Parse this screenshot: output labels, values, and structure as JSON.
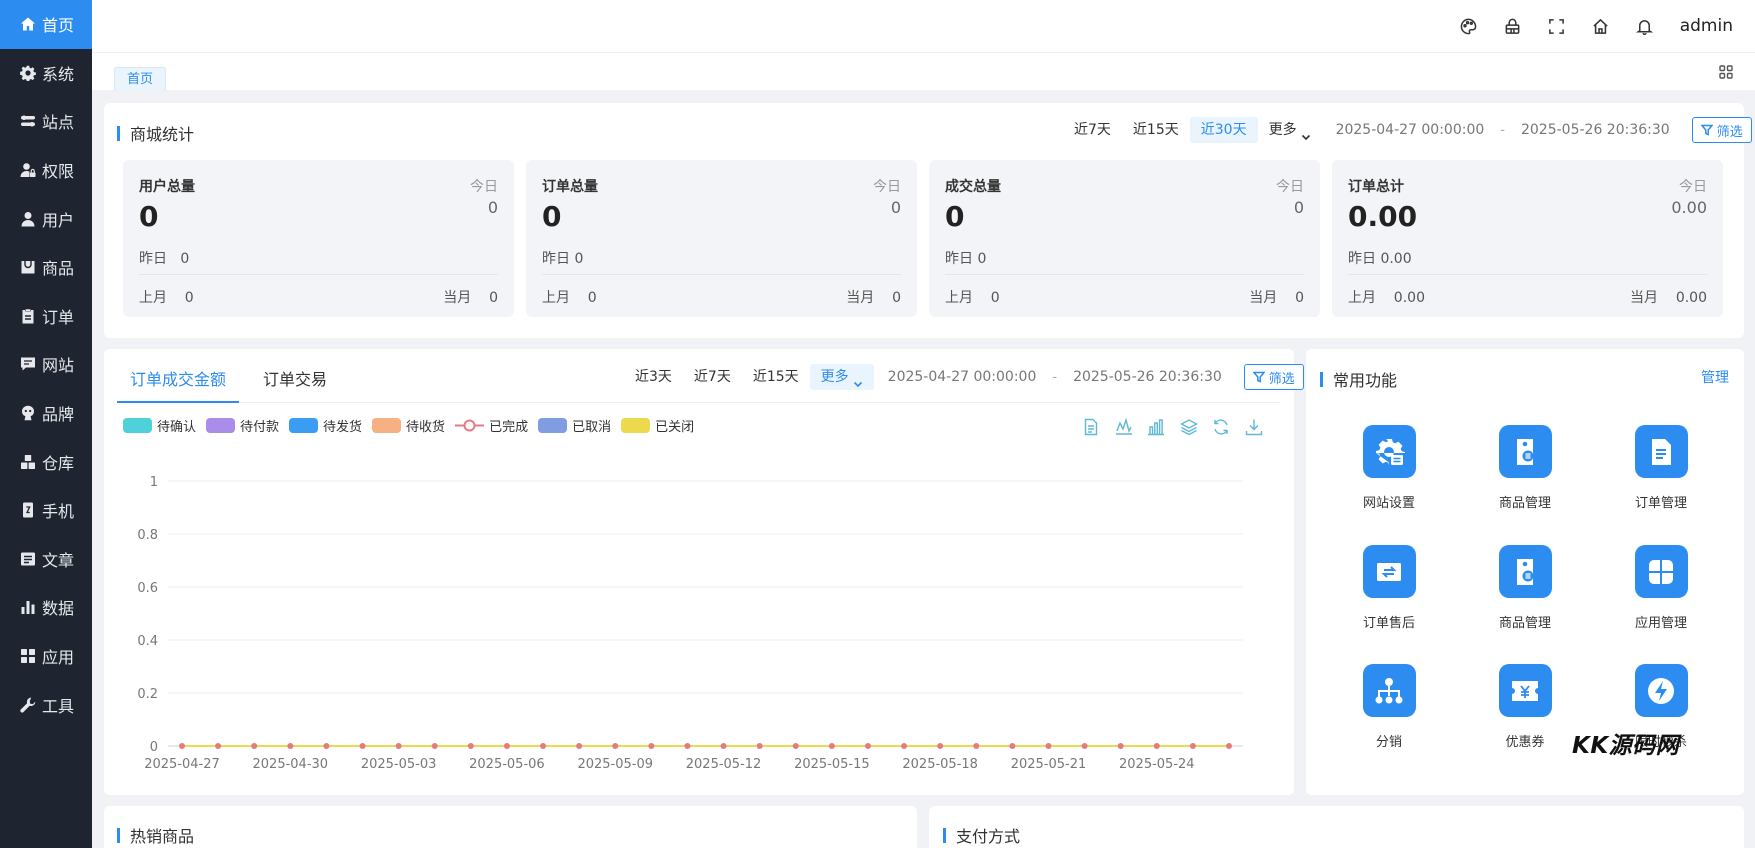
{
  "sidebar": {
    "items": [
      {
        "label": "首页",
        "icon": "home-icon",
        "active": true
      },
      {
        "label": "系统",
        "icon": "gear-icon"
      },
      {
        "label": "站点",
        "icon": "switch-icon"
      },
      {
        "label": "权限",
        "icon": "user-lock-icon"
      },
      {
        "label": "用户",
        "icon": "user-icon"
      },
      {
        "label": "商品",
        "icon": "box-icon"
      },
      {
        "label": "订单",
        "icon": "clipboard-icon"
      },
      {
        "label": "网站",
        "icon": "chat-icon"
      },
      {
        "label": "品牌",
        "icon": "paw-icon"
      },
      {
        "label": "仓库",
        "icon": "cubes-icon"
      },
      {
        "label": "手机",
        "icon": "phone-icon"
      },
      {
        "label": "文章",
        "icon": "article-icon"
      },
      {
        "label": "数据",
        "icon": "bar-chart-icon"
      },
      {
        "label": "应用",
        "icon": "apps-icon"
      },
      {
        "label": "工具",
        "icon": "wrench-icon"
      }
    ]
  },
  "header": {
    "user": "admin",
    "icons": [
      "palette-icon",
      "lock-icon",
      "fullscreen-icon",
      "house-icon",
      "bell-icon"
    ]
  },
  "tabs": {
    "home": "首页"
  },
  "stats": {
    "title": "商城统计",
    "ranges": [
      "近7天",
      "近15天",
      "近30天"
    ],
    "active_range": "近30天",
    "more": "更多",
    "date_from": "2025-04-27 00:00:00",
    "date_sep": "-",
    "date_to": "2025-05-26 20:36:30",
    "filter": "筛选",
    "cards": [
      {
        "title": "用户总量",
        "today_label": "今日",
        "value": "0",
        "today": "0",
        "yesterday": "昨日   0",
        "last_month": "上月    0",
        "this_month": "当月    0"
      },
      {
        "title": "订单总量",
        "today_label": "今日",
        "value": "0",
        "today": "0",
        "yesterday": "昨日 0",
        "last_month": "上月    0",
        "this_month": "当月    0"
      },
      {
        "title": "成交总量",
        "today_label": "今日",
        "value": "0",
        "today": "0",
        "yesterday": "昨日 0",
        "last_month": "上月    0",
        "this_month": "当月    0"
      },
      {
        "title": "订单总计",
        "today_label": "今日",
        "value": "0.00",
        "today": "0.00",
        "yesterday": "昨日 0.00",
        "last_month": "上月    0.00",
        "this_month": "当月    0.00"
      }
    ]
  },
  "orders_chart": {
    "tabs": [
      "订单成交金额",
      "订单交易"
    ],
    "ranges": [
      "近3天",
      "近7天",
      "近15天"
    ],
    "more": "更多",
    "date_from": "2025-04-27 00:00:00",
    "date_sep": "-",
    "date_to": "2025-05-26 20:36:30",
    "filter": "筛选",
    "toolbox": [
      "data-view-icon",
      "line-switch-icon",
      "bar-switch-icon",
      "stack-icon",
      "restore-icon",
      "download-icon"
    ]
  },
  "chart_data": {
    "type": "line",
    "x": [
      "2025-04-27",
      "2025-04-28",
      "2025-04-29",
      "2025-04-30",
      "2025-05-01",
      "2025-05-02",
      "2025-05-03",
      "2025-05-04",
      "2025-05-05",
      "2025-05-06",
      "2025-05-07",
      "2025-05-08",
      "2025-05-09",
      "2025-05-10",
      "2025-05-11",
      "2025-05-12",
      "2025-05-13",
      "2025-05-14",
      "2025-05-15",
      "2025-05-16",
      "2025-05-17",
      "2025-05-18",
      "2025-05-19",
      "2025-05-20",
      "2025-05-21",
      "2025-05-22",
      "2025-05-23",
      "2025-05-24",
      "2025-05-25",
      "2025-05-26"
    ],
    "x_tick_labels": [
      "2025-04-27",
      "2025-04-30",
      "2025-05-03",
      "2025-05-06",
      "2025-05-09",
      "2025-05-12",
      "2025-05-15",
      "2025-05-18",
      "2025-05-21",
      "2025-05-24"
    ],
    "y_ticks": [
      "0",
      "0.2",
      "0.4",
      "0.6",
      "0.8",
      "1"
    ],
    "ylim": [
      0,
      1
    ],
    "grid": true,
    "legend_position": "top-left",
    "series": [
      {
        "name": "待确认",
        "color": "#4fd1d9",
        "values": [
          0,
          0,
          0,
          0,
          0,
          0,
          0,
          0,
          0,
          0,
          0,
          0,
          0,
          0,
          0,
          0,
          0,
          0,
          0,
          0,
          0,
          0,
          0,
          0,
          0,
          0,
          0,
          0,
          0,
          0
        ]
      },
      {
        "name": "待付款",
        "color": "#a98de8",
        "values": [
          0,
          0,
          0,
          0,
          0,
          0,
          0,
          0,
          0,
          0,
          0,
          0,
          0,
          0,
          0,
          0,
          0,
          0,
          0,
          0,
          0,
          0,
          0,
          0,
          0,
          0,
          0,
          0,
          0,
          0
        ]
      },
      {
        "name": "待发货",
        "color": "#3b9cf4",
        "values": [
          0,
          0,
          0,
          0,
          0,
          0,
          0,
          0,
          0,
          0,
          0,
          0,
          0,
          0,
          0,
          0,
          0,
          0,
          0,
          0,
          0,
          0,
          0,
          0,
          0,
          0,
          0,
          0,
          0,
          0
        ]
      },
      {
        "name": "待收货",
        "color": "#f7b082",
        "values": [
          0,
          0,
          0,
          0,
          0,
          0,
          0,
          0,
          0,
          0,
          0,
          0,
          0,
          0,
          0,
          0,
          0,
          0,
          0,
          0,
          0,
          0,
          0,
          0,
          0,
          0,
          0,
          0,
          0,
          0
        ]
      },
      {
        "name": "已完成",
        "color": "#e57b80",
        "values": [
          0,
          0,
          0,
          0,
          0,
          0,
          0,
          0,
          0,
          0,
          0,
          0,
          0,
          0,
          0,
          0,
          0,
          0,
          0,
          0,
          0,
          0,
          0,
          0,
          0,
          0,
          0,
          0,
          0,
          0
        ]
      },
      {
        "name": "已取消",
        "color": "#7f9de0",
        "values": [
          0,
          0,
          0,
          0,
          0,
          0,
          0,
          0,
          0,
          0,
          0,
          0,
          0,
          0,
          0,
          0,
          0,
          0,
          0,
          0,
          0,
          0,
          0,
          0,
          0,
          0,
          0,
          0,
          0,
          0
        ]
      },
      {
        "name": "已关闭",
        "color": "#ecd94d",
        "values": [
          0,
          0,
          0,
          0,
          0,
          0,
          0,
          0,
          0,
          0,
          0,
          0,
          0,
          0,
          0,
          0,
          0,
          0,
          0,
          0,
          0,
          0,
          0,
          0,
          0,
          0,
          0,
          0,
          0,
          0
        ]
      }
    ]
  },
  "quick": {
    "title": "常用功能",
    "manage": "管理",
    "items": [
      {
        "label": "网站设置",
        "icon": "site-settings-icon"
      },
      {
        "label": "商品管理",
        "icon": "product-tag-icon"
      },
      {
        "label": "订单管理",
        "icon": "document-icon"
      },
      {
        "label": "订单售后",
        "icon": "exchange-icon"
      },
      {
        "label": "商品管理",
        "icon": "product-tag-icon"
      },
      {
        "label": "应用管理",
        "icon": "clover-icon"
      },
      {
        "label": "分销",
        "icon": "hierarchy-icon"
      },
      {
        "label": "优惠券",
        "icon": "coupon-icon"
      },
      {
        "label": "限时秒杀",
        "icon": "flash-icon"
      }
    ]
  },
  "bottom": {
    "hot_title": "热销商品",
    "pay_title": "支付方式"
  },
  "watermark": "KK源码网",
  "colors": {
    "accent": "#2d8cf0",
    "sidebar_bg": "#1f2530"
  }
}
